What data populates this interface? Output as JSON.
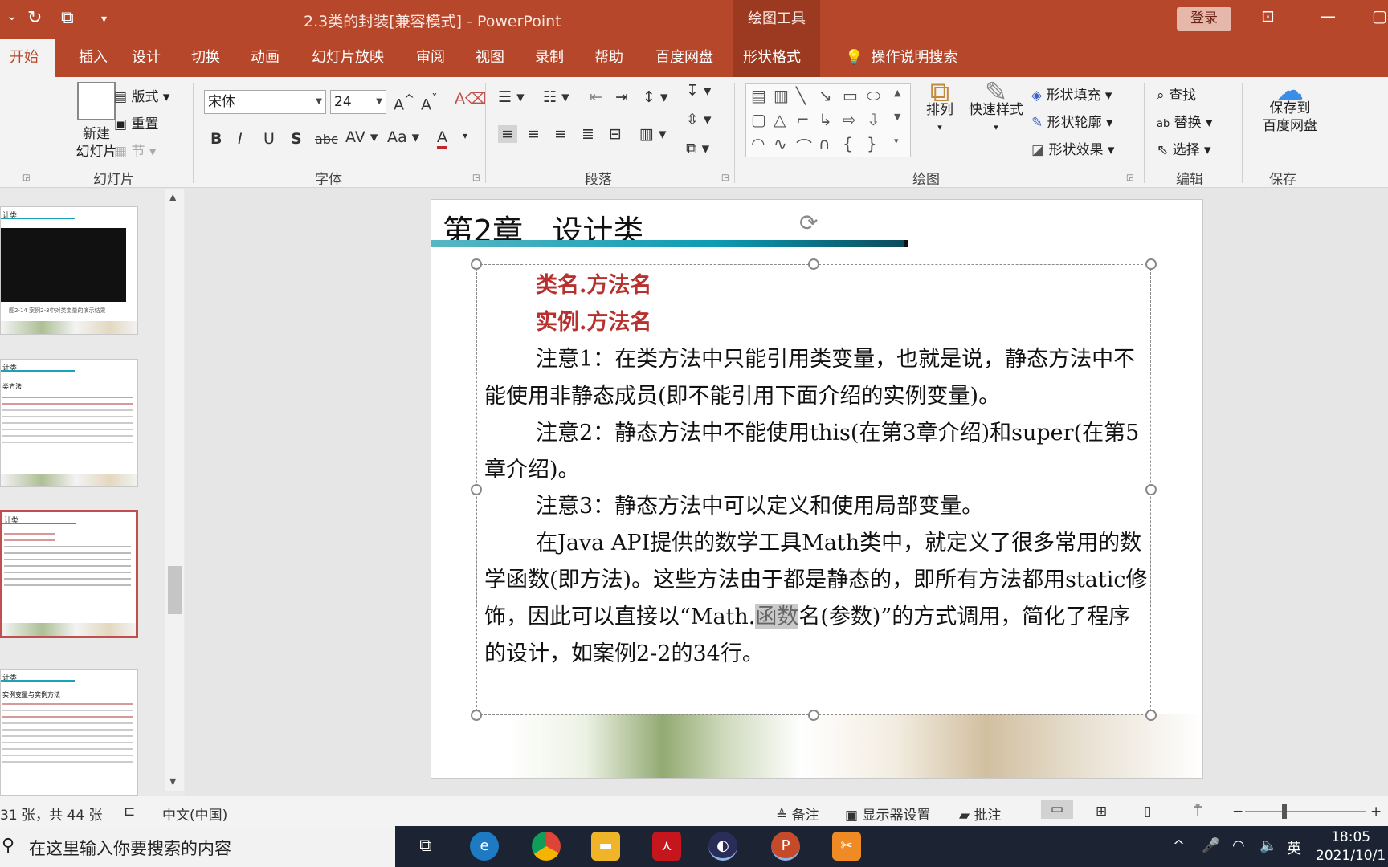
{
  "titlebar": {
    "title": "2.3类的封装[兼容模式]  -  PowerPoint",
    "context_tab": "绘图工具",
    "login": "登录"
  },
  "tabs": [
    "开始",
    "插入",
    "设计",
    "切换",
    "动画",
    "幻灯片放映",
    "审阅",
    "视图",
    "录制",
    "帮助",
    "百度网盘",
    "形状格式",
    "操作说明搜索"
  ],
  "ribbon": {
    "slides_group": {
      "new_slide": "新建\n幻灯片",
      "layout": "版式",
      "reset": "重置",
      "section": "节",
      "label": "幻灯片"
    },
    "font_group": {
      "font_name": "宋体",
      "font_size": "24",
      "label": "字体"
    },
    "paragraph_group": {
      "label": "段落"
    },
    "drawing_group": {
      "arrange": "排列",
      "quick_styles": "快速样式",
      "fill": "形状填充",
      "outline": "形状轮廓",
      "effects": "形状效果",
      "label": "绘图"
    },
    "editing_group": {
      "find": "查找",
      "replace": "替换",
      "select": "选择",
      "label": "编辑"
    },
    "save_group": {
      "save_to": "保存到\n百度网盘",
      "label": "保存"
    }
  },
  "thumbnails": [
    {
      "title": "计类",
      "caption": "图2-14 案例2-3中对类变量的演示结果"
    },
    {
      "title": "计类",
      "sub": "类方法"
    },
    {
      "title": "计类",
      "selected": true
    },
    {
      "title": "计类",
      "sub": "实例变量与实例方法"
    }
  ],
  "slide": {
    "title": "第2章   设计类",
    "lines": {
      "l1": "类名.方法名",
      "l2": "实例.方法名",
      "p1": "注意1：在类方法中只能引用类变量，也就是说，静态方法中不能使用非静态成员(即不能引用下面介绍的实例变量)。",
      "p2": "注意2：静态方法中不能使用this(在第3章介绍)和super(在第5章介绍)。",
      "p3": "注意3：静态方法中可以定义和使用局部变量。",
      "p4a": "在Java API提供的数学工具Math类中，就定义了很多常用的数学函数(即方法)。这些方法由于都是静态的，即所有方法都用static修饰，因此可以直接以“Math.",
      "p4hl": "函数",
      "p4b": "名(参数)”的方式调用，简化了程序的设计，如案例2-2的34行。"
    }
  },
  "statusbar": {
    "slide_count": "31 张，共 44 张",
    "language": "中文(中国)",
    "notes": "备注",
    "display_settings": "显示器设置",
    "comments": "批注"
  },
  "taskbar": {
    "search_placeholder": "在这里输入你要搜索的内容",
    "ime": "英",
    "time": "18:05",
    "date": "2021/10/1"
  }
}
